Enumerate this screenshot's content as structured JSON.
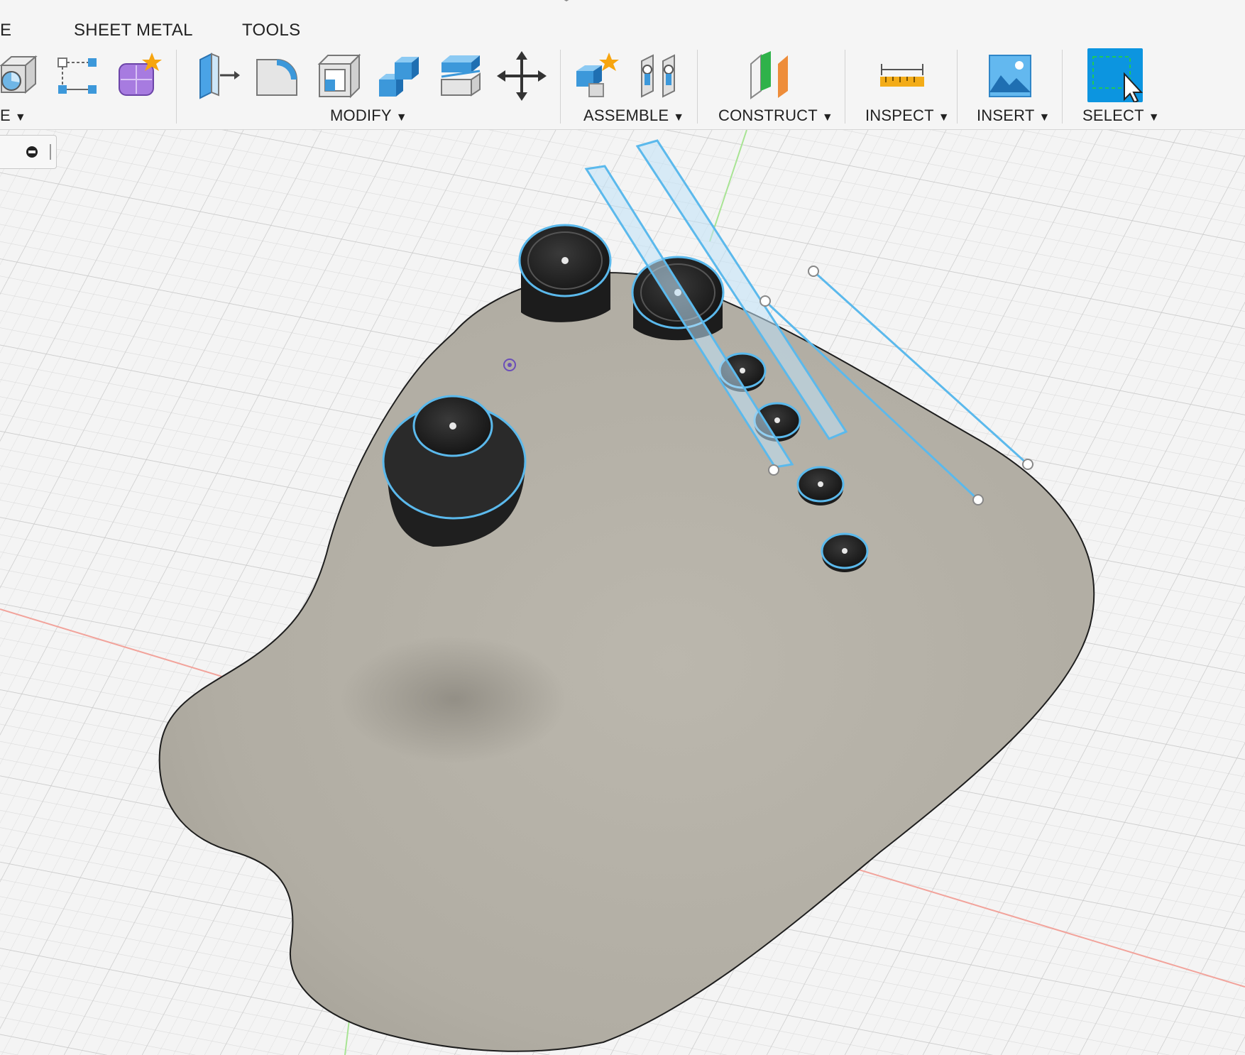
{
  "toolbar": {
    "tabs": [
      {
        "label": "E"
      },
      {
        "label": "SHEET METAL"
      },
      {
        "label": "TOOLS"
      }
    ],
    "groups": [
      {
        "label": "E"
      },
      {
        "label": "MODIFY"
      },
      {
        "label": "ASSEMBLE"
      },
      {
        "label": "CONSTRUCT"
      },
      {
        "label": "INSPECT"
      },
      {
        "label": "INSERT"
      },
      {
        "label": "SELECT"
      }
    ],
    "caret": "▼",
    "tools": [
      "box-sketch-icon",
      "sketch-dimension-icon",
      "create-form-icon",
      "press-pull-icon",
      "fillet-icon",
      "shell-icon",
      "combine-icon",
      "offset-face-icon",
      "move-icon",
      "new-component-icon",
      "joint-icon",
      "offset-plane-icon",
      "measure-icon",
      "insert-canvas-icon",
      "select-window-icon"
    ]
  },
  "colors": {
    "accent": "#1a8fd6",
    "select_bg": "#0c95e0",
    "model": "#b4b0a6",
    "highlight": "#5bb9ec",
    "grid": "#d7d7d7",
    "x_axis": "#f08a82",
    "y_axis": "#9fe08a"
  }
}
